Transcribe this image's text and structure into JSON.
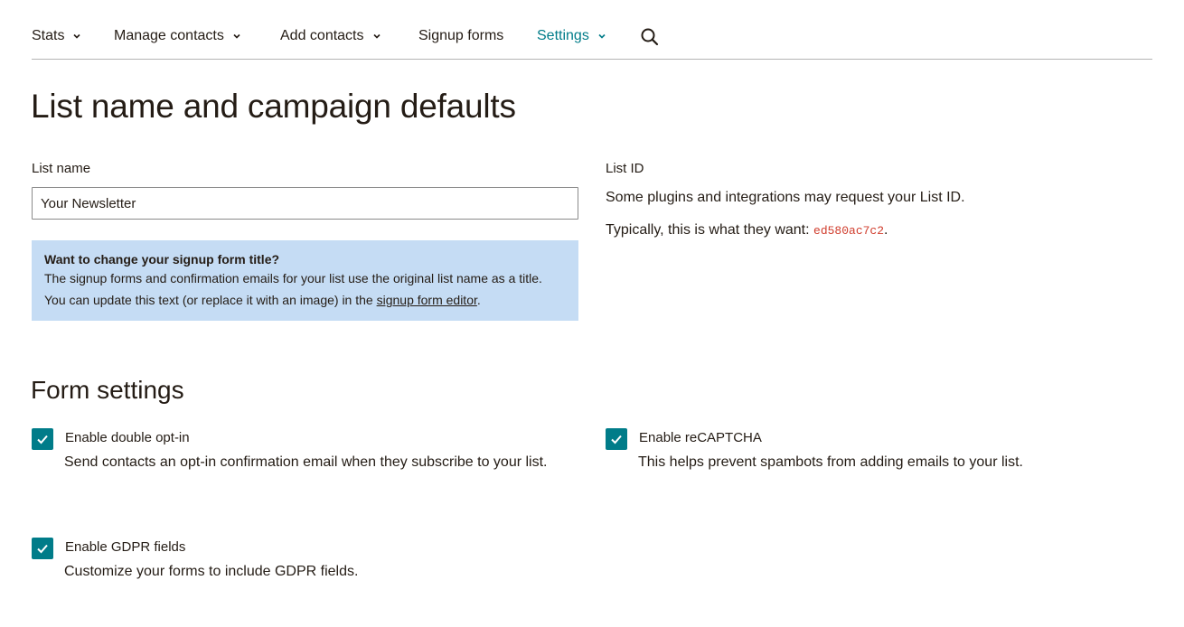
{
  "nav": {
    "items": [
      {
        "label": "Stats",
        "has_dropdown": true
      },
      {
        "label": "Manage contacts",
        "has_dropdown": true
      },
      {
        "label": "Add contacts",
        "has_dropdown": true
      },
      {
        "label": "Signup forms",
        "has_dropdown": false
      },
      {
        "label": "Settings",
        "has_dropdown": true,
        "active": true
      }
    ],
    "search_icon": "search-icon",
    "active_color": "#007c89"
  },
  "page": {
    "title": "List name and campaign defaults"
  },
  "list_name": {
    "label": "List name",
    "value": "Your Newsletter"
  },
  "info_box": {
    "title": "Want to change your signup form title?",
    "text": "The signup forms and confirmation emails for your list use the original list name as a title. You can update this text (or replace it with an image) in the ",
    "link": "signup form editor",
    "end": ".",
    "background": "#c5dcf4"
  },
  "list_id": {
    "label": "List ID",
    "line1": "Some plugins and integrations may request your List ID.",
    "line2_prefix": "Typically, this is what they want: ",
    "id_value": "ed580ac7c2",
    "line2_suffix": "."
  },
  "form_settings": {
    "title": "Form settings",
    "options": {
      "double_optin": {
        "label": "Enable double opt-in",
        "description": "Send contacts an opt-in confirmation email when they subscribe to your list.",
        "checked": true
      },
      "recaptcha": {
        "label": "Enable reCAPTCHA",
        "description": "This helps prevent spambots from adding emails to your list.",
        "checked": true
      },
      "gdpr": {
        "label": "Enable GDPR fields",
        "description": "Customize your forms to include GDPR fields.",
        "checked": true
      }
    },
    "checkbox_color": "#007c89"
  }
}
